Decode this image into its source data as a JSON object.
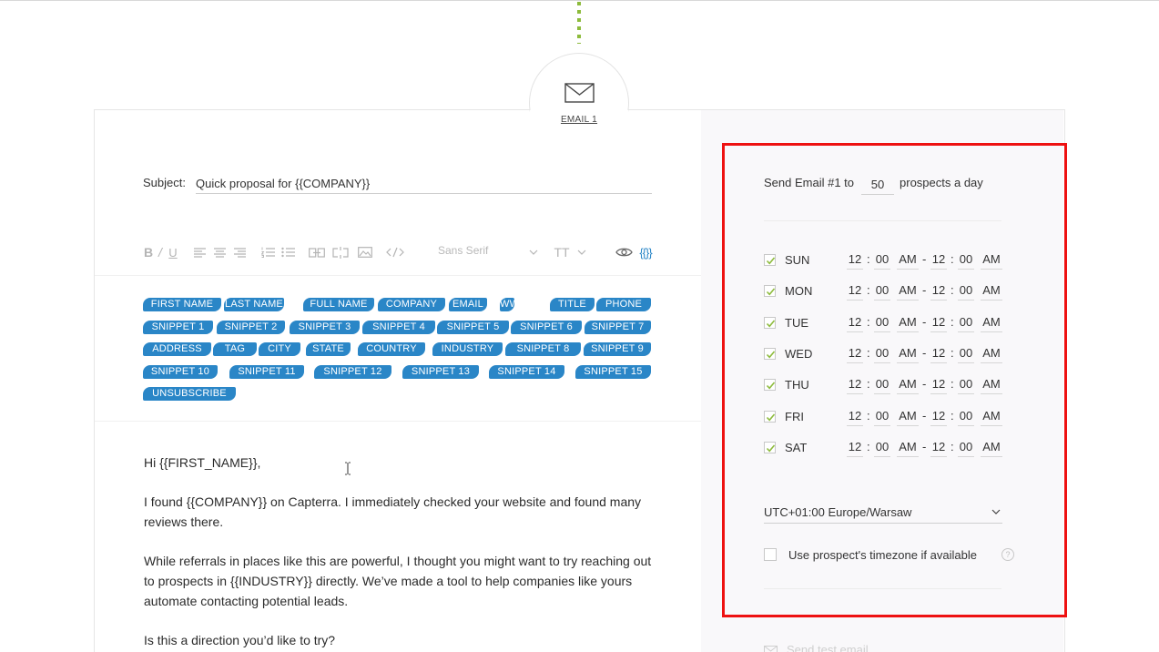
{
  "email_step": {
    "label": "EMAIL 1"
  },
  "subject": {
    "label": "Subject:",
    "value": "Quick proposal for {{COMPANY}}"
  },
  "toolbar": {
    "font": "Sans Serif"
  },
  "tags": [
    [
      "FIRST NAME",
      "LAST NAME",
      "FULL NAME",
      "COMPANY",
      "EMAIL",
      "WWW",
      "TITLE",
      "PHONE"
    ],
    [
      "SNIPPET 1",
      "SNIPPET 2",
      "SNIPPET 3",
      "SNIPPET 4",
      "SNIPPET 5",
      "SNIPPET 6",
      "SNIPPET 7"
    ],
    [
      "ADDRESS",
      "TAG",
      "CITY",
      "STATE",
      "COUNTRY",
      "INDUSTRY",
      "SNIPPET 8",
      "SNIPPET 9"
    ],
    [
      "SNIPPET 10",
      "SNIPPET 11",
      "SNIPPET 12",
      "SNIPPET 13",
      "SNIPPET 14",
      "SNIPPET 15"
    ],
    [
      "UNSUBSCRIBE"
    ]
  ],
  "body": {
    "p1": "Hi {{FIRST_NAME}},",
    "p2": "I found {{COMPANY}} on Capterra. I immediately checked your website and found many reviews there.",
    "p3": "While referrals in places like this are powerful, I thought you might want to try reaching out to prospects in {{INDUSTRY}} directly. We’ve made a tool to help companies like yours automate contacting potential leads.",
    "p4": "Is this a direction you’d like to try?"
  },
  "schedule": {
    "send_prefix": "Send Email #1 to",
    "send_count": "50",
    "send_suffix": "prospects a day",
    "days": [
      {
        "name": "SUN",
        "checked": true,
        "from_h": "12",
        "from_m": "00",
        "from_ap": "AM",
        "to_h": "12",
        "to_m": "00",
        "to_ap": "AM"
      },
      {
        "name": "MON",
        "checked": true,
        "from_h": "12",
        "from_m": "00",
        "from_ap": "AM",
        "to_h": "12",
        "to_m": "00",
        "to_ap": "AM"
      },
      {
        "name": "TUE",
        "checked": true,
        "from_h": "12",
        "from_m": "00",
        "from_ap": "AM",
        "to_h": "12",
        "to_m": "00",
        "to_ap": "AM"
      },
      {
        "name": "WED",
        "checked": true,
        "from_h": "12",
        "from_m": "00",
        "from_ap": "AM",
        "to_h": "12",
        "to_m": "00",
        "to_ap": "AM"
      },
      {
        "name": "THU",
        "checked": true,
        "from_h": "12",
        "from_m": "00",
        "from_ap": "AM",
        "to_h": "12",
        "to_m": "00",
        "to_ap": "AM"
      },
      {
        "name": "FRI",
        "checked": true,
        "from_h": "12",
        "from_m": "00",
        "from_ap": "AM",
        "to_h": "12",
        "to_m": "00",
        "to_ap": "AM"
      },
      {
        "name": "SAT",
        "checked": true,
        "from_h": "12",
        "from_m": "00",
        "from_ap": "AM",
        "to_h": "12",
        "to_m": "00",
        "to_ap": "AM"
      }
    ],
    "timezone": "UTC+01:00 Europe/Warsaw",
    "use_prospect_tz_label": "Use prospect's timezone if available",
    "use_prospect_tz_checked": false,
    "help": "?",
    "test_email_label": "Send test email"
  },
  "colors": {
    "tag_blue": "#2a86c7",
    "check_green": "#8dbb3c",
    "highlight_red": "#ee1111"
  },
  "icons": [
    "envelope-icon",
    "bold-icon",
    "italic-icon",
    "underline-icon",
    "align-left-icon",
    "align-center-icon",
    "align-right-icon",
    "ordered-list-icon",
    "bullet-list-icon",
    "link-icon",
    "unlink-icon",
    "image-icon",
    "code-icon",
    "text-size-icon",
    "eye-icon",
    "variables-icon",
    "chevron-down-icon",
    "help-icon",
    "text-cursor-icon"
  ]
}
